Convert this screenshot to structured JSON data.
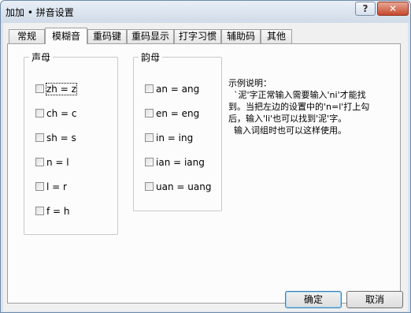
{
  "window": {
    "title": "加加 • 拼音设置",
    "help_glyph": "?",
    "close_glyph": "✕"
  },
  "tabs": [
    {
      "label": "常规"
    },
    {
      "label": "模糊音",
      "active": true
    },
    {
      "label": "重码键"
    },
    {
      "label": "重码显示"
    },
    {
      "label": "打字习惯"
    },
    {
      "label": "辅助码"
    },
    {
      "label": "其他"
    }
  ],
  "shengmu": {
    "label": "声母",
    "items": [
      {
        "label": "zh = z",
        "checked": false
      },
      {
        "label": "ch = c",
        "checked": false
      },
      {
        "label": "sh = s",
        "checked": false
      },
      {
        "label": "n = l",
        "checked": false
      },
      {
        "label": "l = r",
        "checked": false
      },
      {
        "label": "f = h",
        "checked": false
      }
    ]
  },
  "yunmu": {
    "label": "韵母",
    "items": [
      {
        "label": "an = ang",
        "checked": false
      },
      {
        "label": "en = eng",
        "checked": false
      },
      {
        "label": "in = ing",
        "checked": false
      },
      {
        "label": "ian = iang",
        "checked": false
      },
      {
        "label": "uan = uang",
        "checked": false
      }
    ]
  },
  "description": {
    "title": "示例说明：",
    "body": "  `泥'字正常输入需要输入'ni'才能找到。当把左边的设置中的'n=l'打上勾后，输入'li'也可以找到'泥'字。\n  输入词组时也可以这样使用。"
  },
  "buttons": {
    "ok": "确定",
    "cancel": "取消"
  },
  "colors": {
    "frame": "#d9e3ee",
    "close_button": "#c64a2e",
    "panel": "#fcfcfc"
  }
}
